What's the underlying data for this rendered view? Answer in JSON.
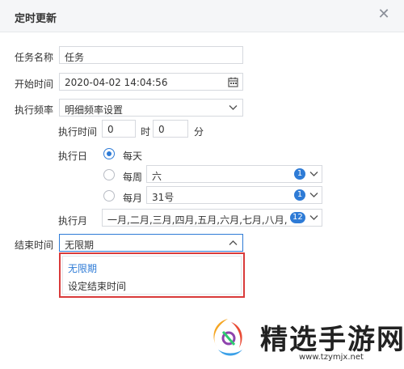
{
  "dialog": {
    "title": "定时更新",
    "close_icon": "close-icon"
  },
  "form": {
    "task_name_label": "任务名称",
    "task_name_value": "任务",
    "start_time_label": "开始时间",
    "start_time_value": "2020-04-02 14:04:56",
    "calendar_icon": "calendar-icon",
    "frequency_label": "执行频率",
    "frequency_value": "明细频率设置",
    "exec_time_label": "执行时间",
    "hour_value": "0",
    "hour_unit": "时",
    "minute_value": "0",
    "minute_unit": "分",
    "exec_day_label": "执行日",
    "daily_label": "每天",
    "weekly_label": "每周",
    "weekly_value": "六",
    "weekly_count": "1",
    "monthly_label": "每月",
    "monthly_value": "31号",
    "monthly_count": "1",
    "exec_month_label": "执行月",
    "exec_month_value": "一月,二月,三月,四月,五月,六月,七月,八月,...",
    "exec_month_count": "12",
    "end_time_label": "结束时间",
    "end_time_value": "无限期",
    "end_time_options": [
      "无限期",
      "设定结束时间"
    ]
  },
  "colors": {
    "accent": "#2e7bd6",
    "highlight_border": "#d93a3a"
  },
  "watermark": {
    "text": "精选手游网",
    "url": "www.tzymjx.net"
  }
}
